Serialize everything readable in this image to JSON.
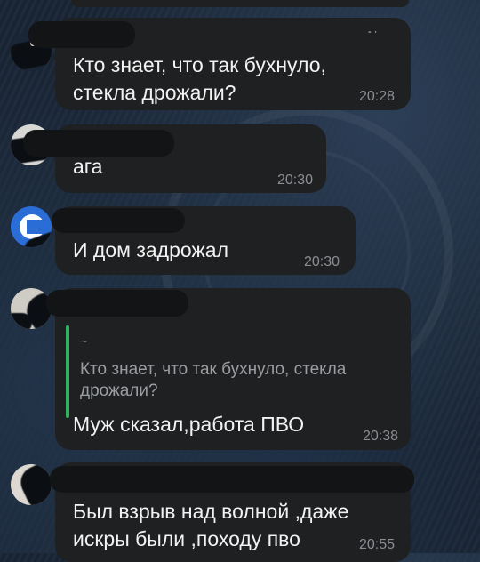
{
  "messages": [
    {
      "text": "Кто знает, что так бухнуло,\nстекла дрожали?",
      "time": "20:28"
    },
    {
      "text": "ага",
      "time": "20:30"
    },
    {
      "text": "И дом задрожал",
      "time": "20:30"
    },
    {
      "quote": {
        "author": "~",
        "text": "Кто знает, что так бухнуло, стекла\nдрожали?"
      },
      "text": "Муж сказал,работа ПВО",
      "time": "20:38"
    },
    {
      "text": "Был взрыв над волной ,даже\nискры были ,походу пво",
      "time": "20:55"
    }
  ],
  "colors": {
    "bubble": "#1f2021",
    "reply_accent": "#2fb35e",
    "time": "#8a8d91"
  }
}
